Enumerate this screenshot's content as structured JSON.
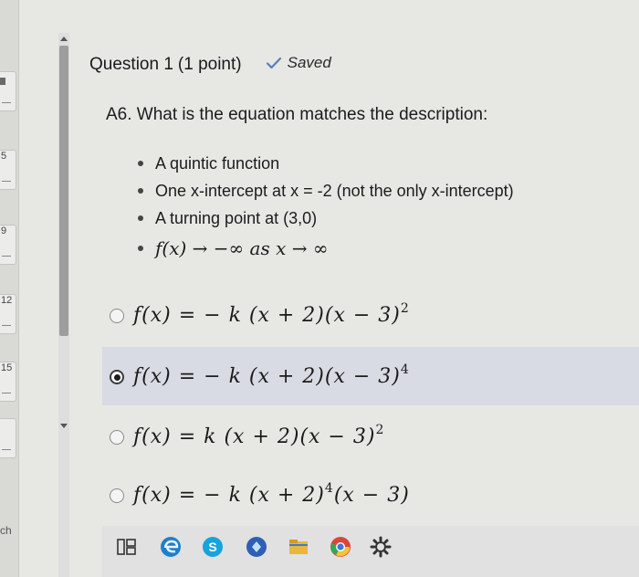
{
  "nav": {
    "tiles": [
      {
        "label": ""
      },
      {
        "label": "5"
      },
      {
        "label": "9"
      },
      {
        "label": "12"
      },
      {
        "label": "15"
      },
      {
        "label": ""
      }
    ],
    "bottom_label": "ch"
  },
  "question": {
    "title": "Question 1",
    "points": "(1 point)",
    "status": "Saved",
    "prompt": "A6. What is the equation matches the description:",
    "bullets": [
      "A quintic function",
      "One x-intercept at x = -2 (not the only x-intercept)",
      "A turning point at (3,0)",
      "f(x) → −∞ as x → ∞"
    ]
  },
  "options": [
    {
      "text": "f(x) = − k (x + 2)(x − 3)",
      "exponent": "2",
      "selected": false
    },
    {
      "text": "f(x) = − k (x + 2)(x − 3)",
      "exponent": "4",
      "selected": true
    },
    {
      "text": "f(x) = k (x + 2)(x − 3)",
      "exponent": "2",
      "selected": false
    },
    {
      "text_a": "f(x) = − k (x + 2)",
      "exponent": "4",
      "text_b": "(x − 3)",
      "selected": false
    }
  ],
  "taskbar": {
    "icons": [
      "task-view-icon",
      "edge-browser-icon",
      "skype-icon",
      "teams-icon",
      "file-explorer-icon",
      "chrome-icon",
      "settings-gear-icon"
    ]
  },
  "colors": {
    "selected_band": "#d8dbe4",
    "checkmark": "#5a7fb8",
    "background": "#e7e7e4"
  }
}
